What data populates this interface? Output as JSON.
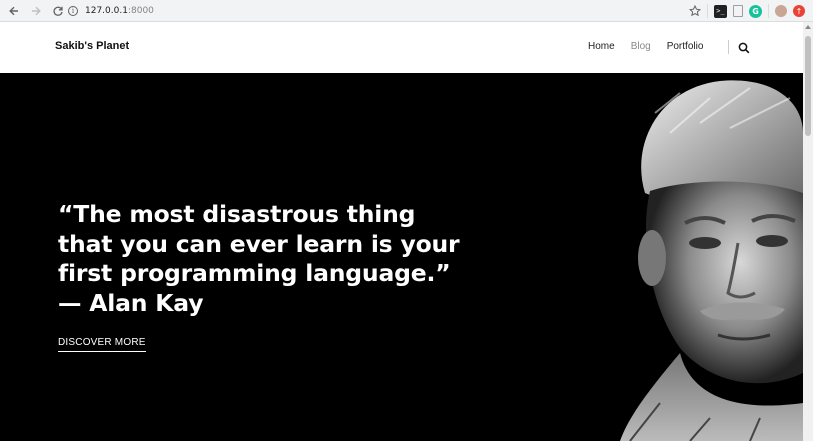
{
  "browser": {
    "back_icon": "arrow-left-icon",
    "forward_icon": "arrow-right-icon",
    "reload_icon": "reload-icon",
    "url_host": "127.0.0.1",
    "url_port": ":8000",
    "extensions": [
      "star-icon",
      "terminal-icon",
      "document-icon",
      "grammarly-icon",
      "profile-avatar",
      "update-icon"
    ]
  },
  "header": {
    "brand": "Sakib's Planet",
    "nav": [
      {
        "label": "Home"
      },
      {
        "label": "Blog"
      },
      {
        "label": "Portfolio"
      }
    ],
    "search_icon": "search-icon"
  },
  "hero": {
    "quote_lines": [
      "“The most disastrous thing",
      "that you can ever learn is your",
      "first programming language.”",
      "— Alan Kay"
    ],
    "cta": "DISCOVER MORE"
  },
  "colors": {
    "hero_bg": "#000000",
    "header_bg": "#ffffff",
    "nav_active": "#8a8a8a",
    "grammarly": "#15c39a"
  }
}
